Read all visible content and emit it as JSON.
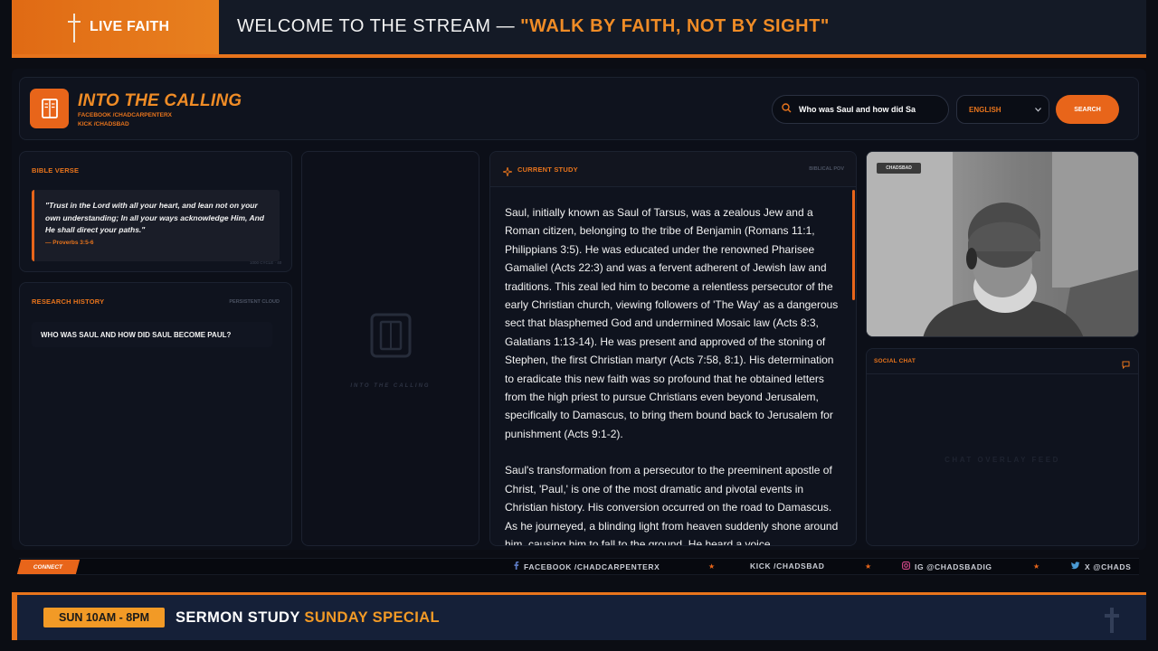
{
  "top_banner": {
    "brand": "LIVE FAITH",
    "welcome_prefix": "WELCOME TO THE STREAM —",
    "welcome_quote": "\"WALK BY FAITH, NOT BY SIGHT\""
  },
  "header": {
    "title": "INTO THE CALLING",
    "subline_1": "FACEBOOK /CHADCARPENTERX",
    "subline_2": "KICK /CHADSBAD",
    "search_value": "Who was Saul and how did Sa",
    "language": "ENGLISH",
    "search_button": "SEARCH"
  },
  "bible_verse": {
    "title": "BIBLE VERSE",
    "text": "\"Trust in the Lord with all your heart, and lean not on your own understanding; In all your ways acknowledge Him, And He shall direct your paths.\"",
    "reference": "— Proverbs 3:5-6",
    "cycle": "1000 CYCLE · 40"
  },
  "research_history": {
    "title": "RESEARCH HISTORY",
    "tag": "PERSISTENT CLOUD",
    "items": [
      "WHO WAS SAUL AND HOW DID SAUL BECOME PAUL?"
    ]
  },
  "placeholder": {
    "label": "INTO THE CALLING"
  },
  "current_study": {
    "title": "CURRENT STUDY",
    "tag": "BIBLICAL POV",
    "paragraph_1": "Saul, initially known as Saul of Tarsus, was a zealous Jew and a Roman citizen, belonging to the tribe of Benjamin (Romans 11:1, Philippians 3:5). He was educated under the renowned Pharisee Gamaliel (Acts 22:3) and was a fervent adherent of Jewish law and traditions. This zeal led him to become a relentless persecutor of the early Christian church, viewing followers of 'The Way' as a dangerous sect that blasphemed God and undermined Mosaic law (Acts 8:3, Galatians 1:13-14). He was present and approved of the stoning of Stephen, the first Christian martyr (Acts 7:58, 8:1). His determination to eradicate this new faith was so profound that he obtained letters from the high priest to pursue Christians even beyond Jerusalem, specifically to Damascus, to bring them bound back to Jerusalem for punishment (Acts 9:1-2).",
    "paragraph_2": "Saul's transformation from a persecutor to the preeminent apostle of Christ, 'Paul,' is one of the most dramatic and pivotal events in Christian history. His conversion occurred on the road to Damascus. As he journeyed, a blinding light from heaven suddenly shone around him, causing him to fall to the ground. He heard a voice"
  },
  "camera": {
    "badge": "CHADSBAD"
  },
  "social_chat": {
    "title": "SOCIAL CHAT",
    "feed_label": "CHAT OVERLAY FEED"
  },
  "connect_ticker": {
    "tag": "CONNECT",
    "items": [
      "FACEBOOK /CHADCARPENTERX",
      "KICK /CHADSBAD",
      "IG @CHADSBADIG",
      "X @CHADS"
    ],
    "separator": "★"
  },
  "bottom_bar": {
    "time": "SUN 10AM - 8PM",
    "label": "SERMON STUDY",
    "highlight": "SUNDAY SPECIAL"
  },
  "colors": {
    "accent": "#e8651a",
    "accent_light": "#f08c26",
    "background": "#0b0d14",
    "panel": "#0f131e",
    "bottom_bar": "#152038"
  },
  "icons": {
    "brand": "cross-icon",
    "logo": "book-icon",
    "search": "search-icon",
    "study": "sparkle-icon",
    "chat": "chat-bubble-icon",
    "facebook": "facebook-icon",
    "instagram": "instagram-icon",
    "twitter": "bird-icon"
  }
}
